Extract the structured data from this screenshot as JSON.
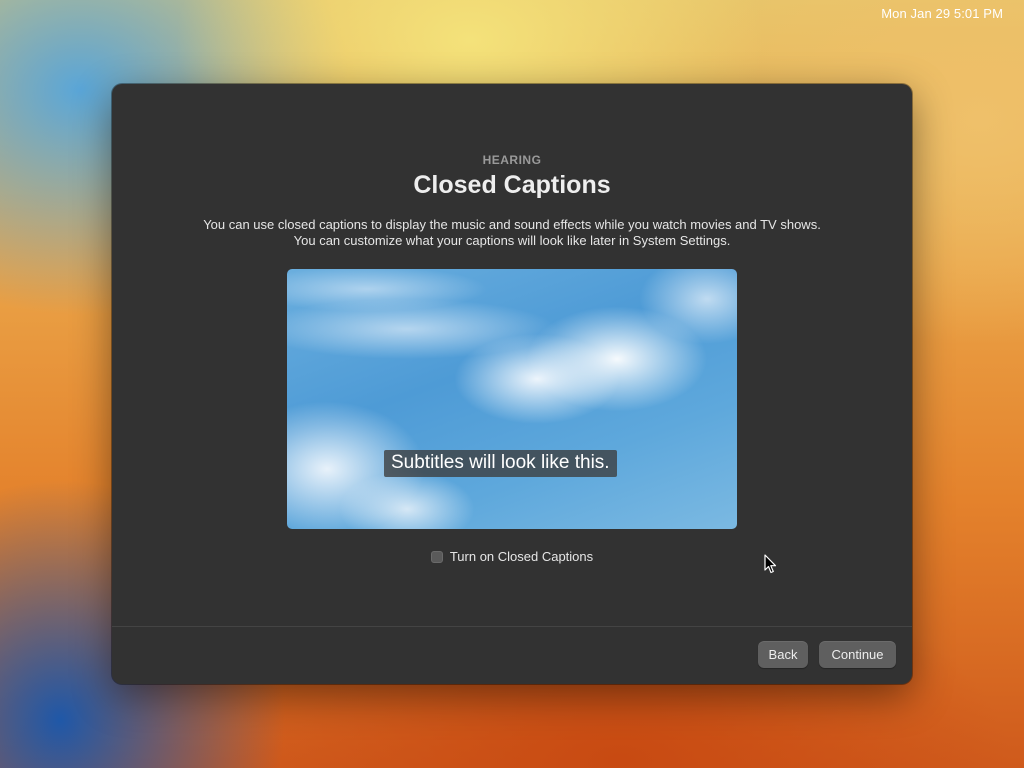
{
  "menubar": {
    "clock": "Mon Jan 29  5:01 PM"
  },
  "setup": {
    "eyebrow": "HEARING",
    "title": "Closed Captions",
    "description": "You can use closed captions to display the music and sound effects while you watch movies and TV shows. You can customize what your captions will look like later in System Settings.",
    "preview_subtitle": "Subtitles will look like this.",
    "checkbox_label": "Turn on Closed Captions",
    "checkbox_checked": false
  },
  "footer": {
    "back_label": "Back",
    "continue_label": "Continue"
  },
  "colors": {
    "window_bg": "#323232",
    "button_bg": "#5f5f5f",
    "text_primary": "#eeeeee",
    "text_secondary": "#9a9a9a"
  },
  "icons": {
    "cursor": "arrow-pointer-icon",
    "checkbox": "checkbox-unchecked-icon"
  }
}
